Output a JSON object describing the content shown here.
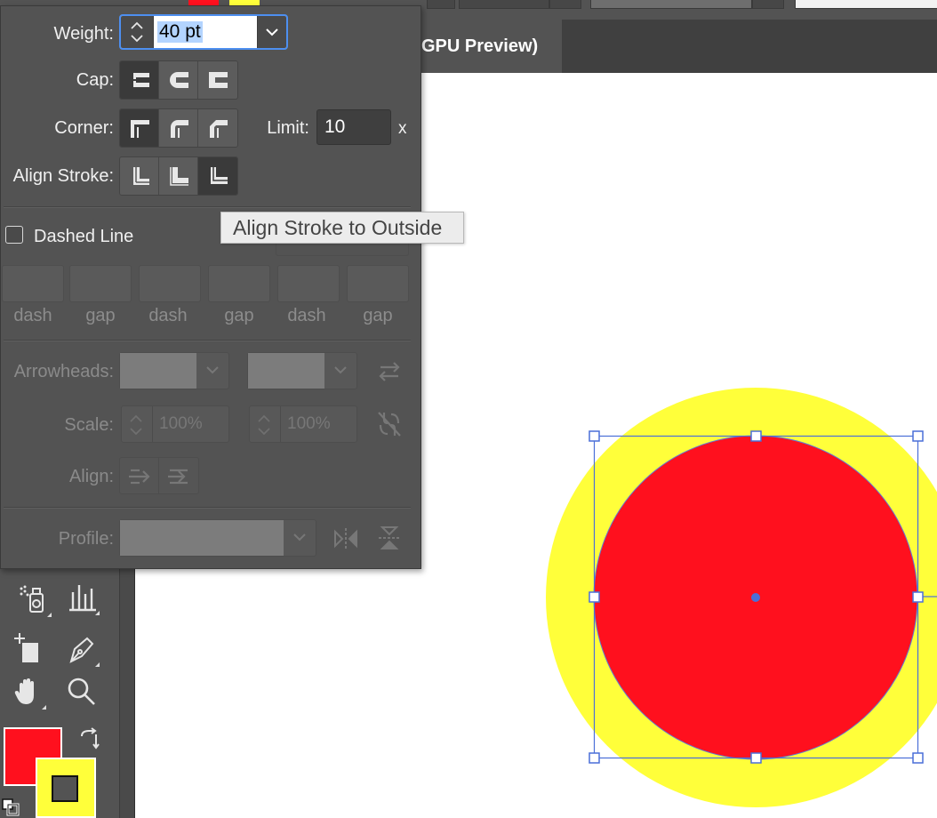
{
  "colors": {
    "accent": "#4d8ff0",
    "fill": "#ff101e",
    "stroke": "#ffff3a",
    "panel_bg": "#535353",
    "tooltip_bg": "#ececec"
  },
  "document": {
    "tab_label": "GPU Preview)"
  },
  "stroke_panel": {
    "weight_label": "Weight:",
    "weight_value": "40 pt",
    "cap_label": "Cap:",
    "caps": [
      "butt-cap-icon",
      "round-cap-icon",
      "projecting-cap-icon"
    ],
    "cap_selected": 0,
    "corner_label": "Corner:",
    "corners": [
      "miter-join-icon",
      "round-join-icon",
      "bevel-join-icon"
    ],
    "corner_selected": 0,
    "limit_label": "Limit:",
    "limit_value": "10",
    "limit_unit": "x",
    "align_label": "Align Stroke:",
    "aligns": [
      "align-center-icon",
      "align-inside-icon",
      "align-outside-icon"
    ],
    "align_selected": 2,
    "dashed_label": "Dashed Line",
    "dashed_checked": false,
    "dash_labels": [
      "dash",
      "gap",
      "dash",
      "gap",
      "dash",
      "gap"
    ],
    "arrowheads_label": "Arrowheads:",
    "scale_label": "Scale:",
    "scale_start": "100%",
    "scale_end": "100%",
    "arrow_align_label": "Align:",
    "profile_label": "Profile:"
  },
  "tooltip": "Align Stroke to Outside",
  "tools": [
    "symbol-sprayer-icon",
    "graph-icon",
    "artboard-icon",
    "pen-icon",
    "hand-icon",
    "zoom-icon"
  ],
  "color_controls": {
    "fill_color": "#ff101e",
    "stroke_color": "#ffff3a",
    "icons": [
      "swap-fill-stroke-icon",
      "default-colors-icon"
    ]
  },
  "artwork": {
    "shape": "circle",
    "fill": "#ff101e",
    "stroke": "#ffff3a",
    "stroke_align": "outside"
  }
}
